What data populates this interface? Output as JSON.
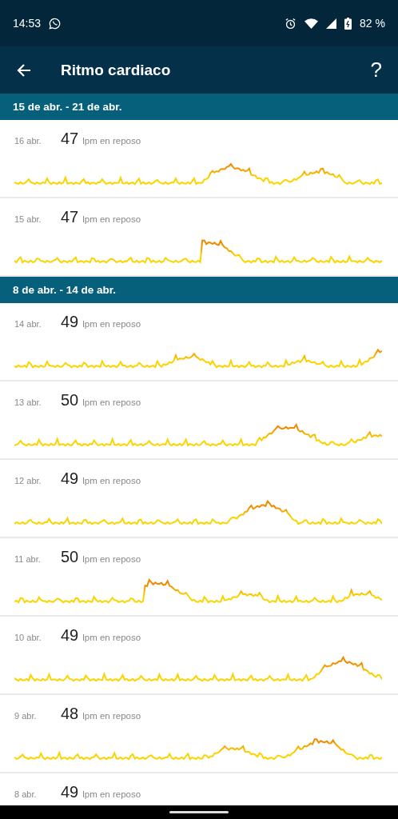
{
  "status_bar": {
    "time": "14:53",
    "battery": "82 %"
  },
  "app_bar": {
    "title": "Ritmo cardiaco",
    "help": "?"
  },
  "weeks": [
    {
      "label": "15 de abr. - 21 de abr.",
      "days": [
        {
          "date": "16 abr.",
          "value": "47",
          "unit": "lpm en reposo"
        },
        {
          "date": "15 abr.",
          "value": "47",
          "unit": "lpm en reposo"
        }
      ]
    },
    {
      "label": "8 de abr. - 14 de abr.",
      "days": [
        {
          "date": "14 abr.",
          "value": "49",
          "unit": "lpm en reposo"
        },
        {
          "date": "13 abr.",
          "value": "50",
          "unit": "lpm en reposo"
        },
        {
          "date": "12 abr.",
          "value": "49",
          "unit": "lpm en reposo"
        },
        {
          "date": "11 abr.",
          "value": "50",
          "unit": "lpm en reposo"
        },
        {
          "date": "10 abr.",
          "value": "49",
          "unit": "lpm en reposo"
        },
        {
          "date": "9 abr.",
          "value": "48",
          "unit": "lpm en reposo"
        },
        {
          "date": "8 abr.",
          "value": "49",
          "unit": "lpm en reposo"
        }
      ]
    }
  ]
}
